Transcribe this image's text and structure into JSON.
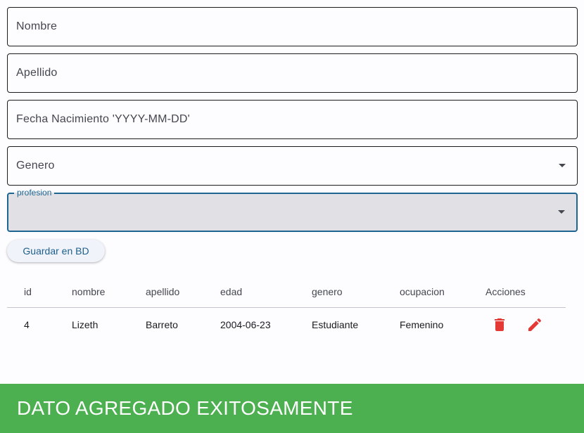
{
  "form": {
    "nombre": {
      "placeholder": "Nombre",
      "value": ""
    },
    "apellido": {
      "placeholder": "Apellido",
      "value": ""
    },
    "fecha": {
      "placeholder": "Fecha Nacimiento 'YYYY-MM-DD'",
      "value": ""
    },
    "genero": {
      "placeholder": "Genero",
      "value": ""
    },
    "profesion": {
      "label": "profesion",
      "value": ""
    }
  },
  "actions": {
    "save_label": "Guardar en BD"
  },
  "table": {
    "headers": [
      "id",
      "nombre",
      "apellido",
      "edad",
      "genero",
      "ocupacion",
      "Acciones"
    ],
    "rows": [
      [
        "4",
        "Lizeth",
        "Barreto",
        "2004-06-23",
        "Estudiante",
        "Femenino"
      ]
    ]
  },
  "snackbar": {
    "message": "DATO AGREGADO EXITOSAMENTE",
    "color": "#4caf50"
  },
  "colors": {
    "accent": "#1f6591",
    "danger": "#e53935"
  },
  "icons": {
    "delete": "trash-icon",
    "edit": "pencil-icon",
    "dropdown": "dropdown-arrow-icon"
  }
}
